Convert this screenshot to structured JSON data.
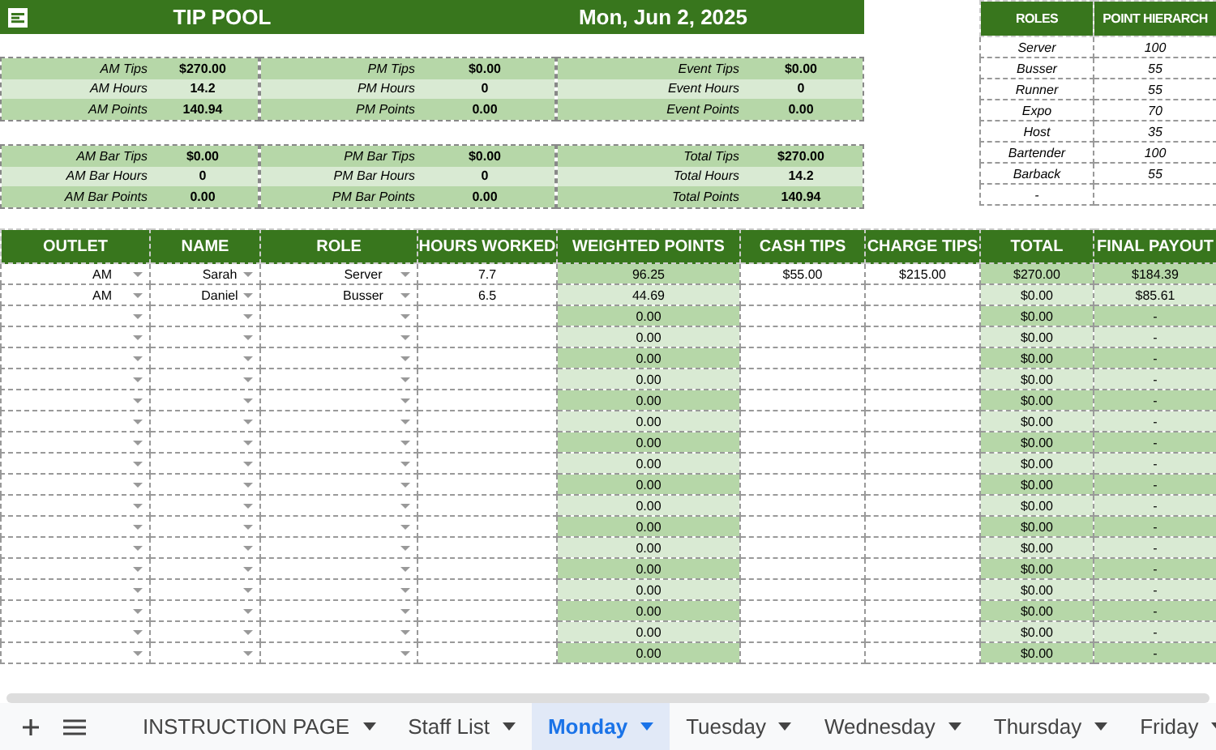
{
  "header": {
    "title": "TIP POOL",
    "date": "Mon, Jun 2, 2025"
  },
  "summary": [
    [
      {
        "label": "AM Tips",
        "value": "$270.00"
      },
      {
        "label": "AM Hours",
        "value": "14.2"
      },
      {
        "label": "AM Points",
        "value": "140.94"
      }
    ],
    [
      {
        "label": "PM Tips",
        "value": "$0.00"
      },
      {
        "label": "PM Hours",
        "value": "0"
      },
      {
        "label": "PM Points",
        "value": "0.00"
      }
    ],
    [
      {
        "label": "Event Tips",
        "value": "$0.00"
      },
      {
        "label": "Event Hours",
        "value": "0"
      },
      {
        "label": "Event Points",
        "value": "0.00"
      }
    ],
    [
      {
        "label": "AM Bar Tips",
        "value": "$0.00"
      },
      {
        "label": "AM Bar Hours",
        "value": "0"
      },
      {
        "label": "AM Bar Points",
        "value": "0.00"
      }
    ],
    [
      {
        "label": "PM Bar Tips",
        "value": "$0.00"
      },
      {
        "label": "PM Bar Hours",
        "value": "0"
      },
      {
        "label": "PM Bar Points",
        "value": "0.00"
      }
    ],
    [
      {
        "label": "Total Tips",
        "value": "$270.00"
      },
      {
        "label": "Total Hours",
        "value": "14.2"
      },
      {
        "label": "Total Points",
        "value": "140.94"
      }
    ]
  ],
  "roles": {
    "columns": [
      "ROLES",
      "POINT HIERARCH"
    ],
    "rows": [
      {
        "role": "Server",
        "points": "100"
      },
      {
        "role": "Busser",
        "points": "55"
      },
      {
        "role": "Runner",
        "points": "55"
      },
      {
        "role": "Expo",
        "points": "70"
      },
      {
        "role": "Host",
        "points": "35"
      },
      {
        "role": "Bartender",
        "points": "100"
      },
      {
        "role": "Barback",
        "points": "55"
      },
      {
        "role": "-"
      }
    ]
  },
  "table": {
    "columns": [
      {
        "label": "OUTLET",
        "kind": "dropdown"
      },
      {
        "label": "NAME",
        "kind": "dropdown"
      },
      {
        "label": "ROLE",
        "kind": "dropdown"
      },
      {
        "label": "HOURS WORKED",
        "kind": "input"
      },
      {
        "label": "WEIGHTED POINTS",
        "kind": "computed"
      },
      {
        "label": "CASH TIPS",
        "kind": "input"
      },
      {
        "label": "CHARGE TIPS",
        "kind": "input"
      },
      {
        "label": "TOTAL",
        "kind": "computed"
      },
      {
        "label": "FINAL PAYOUT",
        "kind": "computed"
      }
    ],
    "rows": [
      {
        "outlet": "AM",
        "name": "Sarah",
        "role": "Server",
        "hours_worked": "7.7",
        "weighted_points": "96.25",
        "cash_tips": "$55.00",
        "charge_tips": "$215.00",
        "total": "$270.00",
        "final_payout": "$184.39"
      },
      {
        "outlet": "AM",
        "name": "Daniel",
        "role": "Busser",
        "hours_worked": "6.5",
        "weighted_points": "44.69",
        "total": "$0.00",
        "final_payout": "$85.61"
      },
      {
        "weighted_points": "0.00",
        "total": "$0.00",
        "final_payout": "-"
      },
      {
        "weighted_points": "0.00",
        "total": "$0.00",
        "final_payout": "-"
      },
      {
        "weighted_points": "0.00",
        "total": "$0.00",
        "final_payout": "-"
      },
      {
        "weighted_points": "0.00",
        "total": "$0.00",
        "final_payout": "-"
      },
      {
        "weighted_points": "0.00",
        "total": "$0.00",
        "final_payout": "-"
      },
      {
        "weighted_points": "0.00",
        "total": "$0.00",
        "final_payout": "-"
      },
      {
        "weighted_points": "0.00",
        "total": "$0.00",
        "final_payout": "-"
      },
      {
        "weighted_points": "0.00",
        "total": "$0.00",
        "final_payout": "-"
      },
      {
        "weighted_points": "0.00",
        "total": "$0.00",
        "final_payout": "-"
      },
      {
        "weighted_points": "0.00",
        "total": "$0.00",
        "final_payout": "-"
      },
      {
        "weighted_points": "0.00",
        "total": "$0.00",
        "final_payout": "-"
      },
      {
        "weighted_points": "0.00",
        "total": "$0.00",
        "final_payout": "-"
      },
      {
        "weighted_points": "0.00",
        "total": "$0.00",
        "final_payout": "-"
      },
      {
        "weighted_points": "0.00",
        "total": "$0.00",
        "final_payout": "-"
      },
      {
        "weighted_points": "0.00",
        "total": "$0.00",
        "final_payout": "-"
      },
      {
        "weighted_points": "0.00",
        "total": "$0.00",
        "final_payout": "-"
      },
      {
        "weighted_points": "0.00",
        "total": "$0.00",
        "final_payout": "-"
      }
    ]
  },
  "sheet_tabs": [
    {
      "label": "INSTRUCTION PAGE",
      "selected": false
    },
    {
      "label": "Staff List",
      "selected": false
    },
    {
      "label": "Monday",
      "selected": true
    },
    {
      "label": "Tuesday",
      "selected": false
    },
    {
      "label": "Wednesday",
      "selected": false
    },
    {
      "label": "Thursday",
      "selected": false
    },
    {
      "label": "Friday",
      "selected": false
    }
  ]
}
